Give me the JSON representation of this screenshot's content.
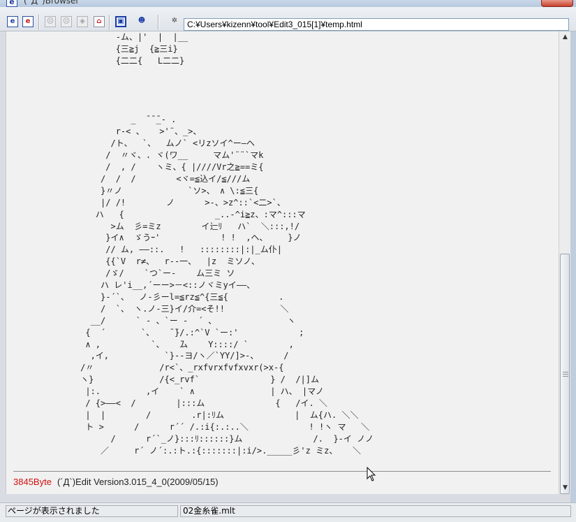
{
  "window": {
    "title": "(´Д`)Browser",
    "title_icon": "e"
  },
  "toolbar": {
    "buttons": [
      {
        "name": "back-button",
        "glyph": "e"
      },
      {
        "name": "forward-button",
        "glyph": "e"
      },
      {
        "name": "face-button-1",
        "glyph": "☹"
      },
      {
        "name": "face-button-2",
        "glyph": "☹"
      },
      {
        "name": "nav-button",
        "glyph": "◈"
      },
      {
        "name": "home-button",
        "glyph": "⌂"
      },
      {
        "name": "view-button",
        "glyph": "▣"
      },
      {
        "name": "aa-button",
        "glyph": "☻"
      },
      {
        "name": "settings-button",
        "glyph": "✲"
      }
    ],
    "address": "C:¥Users¥kizenn¥tool¥Edit3_015[1]¥temp.html"
  },
  "content": {
    "ascii_art": "            -ム、|'  |  |__\n            {三≧j  {≧三i}\n            {二二{   L二二}\n\n\n\n\n               _  ̄ ̄ ̄_- .\n            r-< 、   >'¨、_>、\n           /ト、  `、  ムノ` <リzソイ^ー―ヘ\n          /  〃ヾ、. ヾ(ワ__     マム'¨¨`マk\n          /  , /    ヽミ、{ |////Vr之≧==ミ{\n         /  /  /        <ヾ=≦込イ/≦///ム\n         }〃ノ             `ソ>、 ∧ \\:≦三{\n         |/ /!        ノ      >-、>z^::`<二>`、\n        ハ   {                  _..-^i≧z、:マ^:::マ\n           >ム  彡=ミz        イ辷ﾘ   ハ`  ＼:::,!/\n          }イ∧  ゞうｰ'            ! !  ,ヘ、    }ノ\n          // ム, ――::.   !   ::::::::|:|_ム仆|\n          {{`V  r≠、  r--一、  |z  ミソノ、\n          /ゞ/    `つ`ー‐    ム三ミ ソ\n         ハ レ'i__,´ーー>－<::ノヾミyイ――、\n         }-´`、  ノ-彡ーl=≦rz≦^{三≦{          .\n         /  `、 ヽ.ノ-三}イ/介=<そ!!           ＼\n       __/      ` ‐ 、`ー ‐  ´ 、              ヽ\n      {  ´       `、   ̄ ̄}/.:^`V `ー:'            ;\n      ∧ ,          `、   ̄ム    Y::::/ `        ,\n       ,イ,           `}--ヨ/ヽ／`YY/]>-、     /\n     /〃             /r<`、_rxfvrxfvfxvxr(>x-{\n     ヽ}             /{<_rvf`              } /  /|]ム\n      |:.         ,イ    ` ∧               | ハ、 |マノ\n      / {>――<  /        |:::ム              {   /イ. ＼\n      |  |        /        .r|:ﾘム              |  ム{ハ. ＼＼\n      ト >      /      r´´ /.:i{:.:..＼            ! !ヽ マ   ＼\n           /      r´`_ノ}:::ﾘ::::::}ム              /.  }-イ ノノ\n         ／     r´ ノ´:.:ト.:{:::::::|:i/>._____彡'z ミz、   ＼"
  },
  "footer": {
    "bytes": "3845Byte",
    "app": "(´Д`)Edit Version3.015_4_0(2009/05/15)"
  },
  "statusbar": {
    "status": "ページが表示されました",
    "filename": "02金糸雀.mlt"
  }
}
